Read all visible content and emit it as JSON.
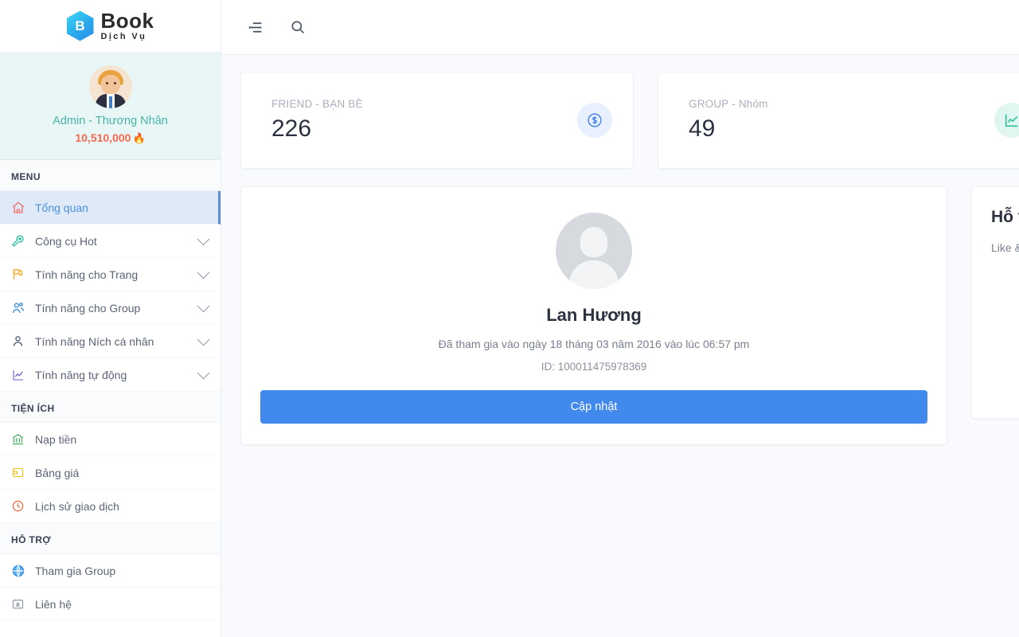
{
  "brand": {
    "mark_letter": "B",
    "name": "Book",
    "tagline": "Dịch Vụ"
  },
  "user": {
    "name": "Admin - Thương Nhân",
    "balance": "10,510,000",
    "balance_icon": "flame-icon",
    "avatar_icon": "user-avatar"
  },
  "sidebar": {
    "menu_label": "MENU",
    "menu_items": [
      {
        "label": "Tổng quan",
        "icon": "home-icon",
        "active": true,
        "has_chevron": false
      },
      {
        "label": "Công cụ Hot",
        "icon": "wrench-icon",
        "active": false,
        "has_chevron": true
      },
      {
        "label": "Tính năng cho Trang",
        "icon": "flag-icon",
        "active": false,
        "has_chevron": true
      },
      {
        "label": "Tính năng cho Group",
        "icon": "users-icon",
        "active": false,
        "has_chevron": true
      },
      {
        "label": "Tính năng Ních cá nhân",
        "icon": "user-icon",
        "active": false,
        "has_chevron": true
      },
      {
        "label": "Tính năng tự động",
        "icon": "chart-icon",
        "active": false,
        "has_chevron": true
      }
    ],
    "utility_label": "TIỆN ÍCH",
    "utility_items": [
      {
        "label": "Nạp tiền",
        "icon": "bank-icon"
      },
      {
        "label": "Bảng giá",
        "icon": "wallet-icon"
      },
      {
        "label": "Lịch sử giao dịch",
        "icon": "clock-icon"
      }
    ],
    "support_label": "HỖ TRỢ",
    "support_items": [
      {
        "label": "Tham gia Group",
        "icon": "globe-icon"
      },
      {
        "label": "Liên hệ",
        "icon": "contact-card-icon"
      }
    ]
  },
  "topbar": {
    "menu_toggle_icon": "menu-collapse-icon",
    "search_icon": "search-icon"
  },
  "stats": [
    {
      "title": "FRIEND - BẠN BÈ",
      "value": "226",
      "icon": "dollar-circle-icon",
      "bubble_color": "#e8f0fd",
      "icon_color": "#4a86e8"
    },
    {
      "title": "GROUP - Nhóm",
      "value": "49",
      "icon": "line-chart-icon",
      "bubble_color": "#e2f6f1",
      "icon_color": "#2fc29a"
    }
  ],
  "profile": {
    "avatar_icon": "default-avatar-icon",
    "name": "Lan Hương",
    "joined": "Đã tham gia vào ngày 18 tháng 03 năm 2016 vào lúc 06:57 pm",
    "id": "ID: 100011475978369",
    "update_button": "Cập nhật"
  },
  "support_panel": {
    "title": "Hỗ trợ",
    "text": "Like & theo dõi"
  },
  "colors": {
    "accent_blue": "#4189ec",
    "active_bg": "#dfe9f7",
    "active_border": "#5b8fd0",
    "user_name": "#4bb3a4",
    "balance": "#f4684f",
    "page_bg": "#f8fafd"
  }
}
